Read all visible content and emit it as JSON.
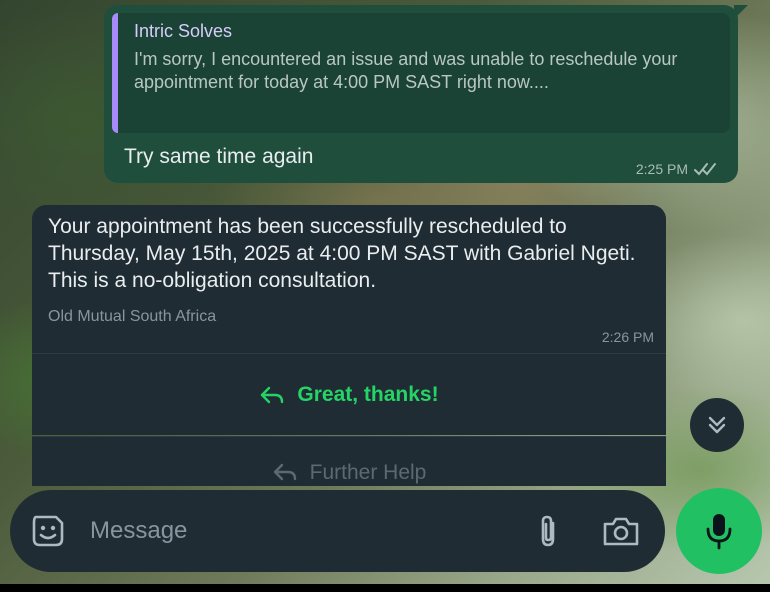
{
  "chat": {
    "outgoing": {
      "quote_sender": "Intric Solves",
      "quote_text": "I'm sorry, I encountered an issue and was unable to reschedule your appointment for today at 4:00 PM SAST right now....",
      "text": "Try same time again",
      "time": "2:25 PM",
      "status_icon": "double-check-read"
    },
    "incoming": {
      "text": "Your appointment has been successfully rescheduled to Thursday, May 15th, 2025 at 4:00 PM SAST with Gabriel Ngeti. This is a no-obligation consultation.",
      "footer": "Old Mutual South Africa",
      "time": "2:26 PM",
      "buttons": [
        {
          "label": "Great, thanks!",
          "icon": "reply-icon"
        },
        {
          "label": "Further Help",
          "icon": "reply-icon"
        }
      ]
    }
  },
  "composer": {
    "placeholder": "Message",
    "icons": [
      "emoji-sticker-icon",
      "paperclip-icon",
      "camera-icon",
      "mic-icon"
    ]
  },
  "colors": {
    "outgoing_bubble": "#1f4e3d",
    "incoming_bubble": "#1f2c33",
    "accent_green": "#25d366",
    "quote_bar": "#a78bfa"
  }
}
